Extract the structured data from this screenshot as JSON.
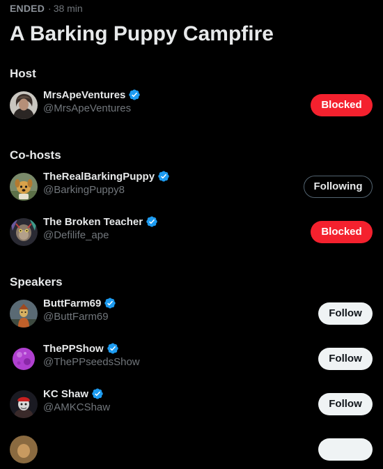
{
  "space": {
    "status": "ENDED",
    "duration": "38 min",
    "title": "A Barking Puppy Campfire"
  },
  "sections": {
    "host": "Host",
    "cohosts": "Co-hosts",
    "speakers": "Speakers"
  },
  "host": {
    "name": "MrsApeVentures",
    "handle": "@MrsApeVentures",
    "verified": true,
    "button": "Blocked",
    "avatar_icon": "user-avatar"
  },
  "cohosts": [
    {
      "name": "TheRealBarkingPuppy",
      "handle": "@BarkingPuppy8",
      "verified": true,
      "button": "Following",
      "avatar_icon": "user-avatar"
    },
    {
      "name": "The Broken Teacher",
      "handle": "@Defilife_ape",
      "verified": true,
      "button": "Blocked",
      "avatar_icon": "user-avatar"
    }
  ],
  "speakers": [
    {
      "name": "ButtFarm69",
      "handle": "@ButtFarm69",
      "verified": true,
      "button": "Follow",
      "avatar_icon": "user-avatar"
    },
    {
      "name": "ThePPShow",
      "handle": "@ThePPseedsShow",
      "verified": true,
      "button": "Follow",
      "avatar_icon": "user-avatar"
    },
    {
      "name": "KC Shaw",
      "handle": "@AMKCShaw",
      "verified": true,
      "button": "Follow",
      "avatar_icon": "user-avatar"
    }
  ],
  "colors": {
    "background": "#000000",
    "verified_blue": "#1d9bf0",
    "blocked_red": "#f4212e",
    "muted_text": "#71767b"
  }
}
